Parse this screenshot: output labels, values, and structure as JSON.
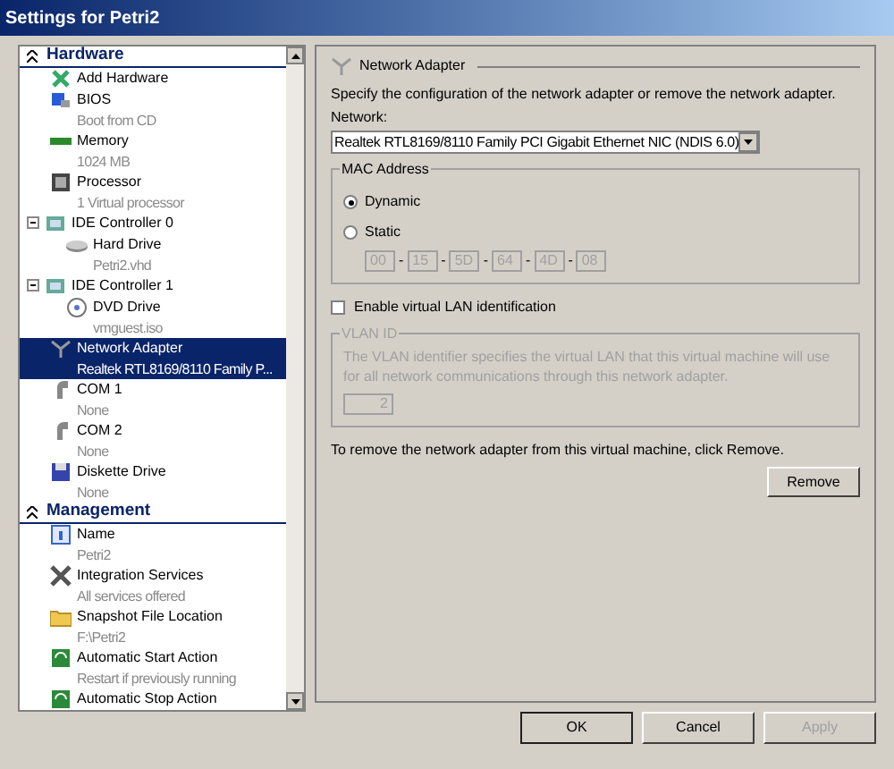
{
  "window": {
    "title": "Settings for Petri2"
  },
  "sidebar": {
    "sections": [
      {
        "label": "Hardware",
        "expanded": true,
        "items": [
          {
            "label": "Add Hardware",
            "kind": "add",
            "selected": false
          },
          {
            "label": "BIOS",
            "detail": "Boot from CD",
            "kind": "bios",
            "selected": false
          },
          {
            "label": "Memory",
            "detail": "1024 MB",
            "kind": "memory",
            "selected": false
          },
          {
            "label": "Processor",
            "detail": "1 Virtual processor",
            "kind": "cpu",
            "selected": false
          },
          {
            "label": "IDE Controller 0",
            "kind": "ide",
            "selected": false,
            "expanded": true,
            "children": [
              {
                "label": "Hard Drive",
                "detail": "Petri2.vhd",
                "kind": "disk",
                "selected": false
              }
            ]
          },
          {
            "label": "IDE Controller 1",
            "kind": "ide",
            "selected": false,
            "expanded": true,
            "children": [
              {
                "label": "DVD Drive",
                "detail": "vmguest.iso",
                "kind": "dvd",
                "selected": false
              }
            ]
          },
          {
            "label": "Network Adapter",
            "detail": "Realtek RTL8169/8110 Family P...",
            "kind": "net",
            "selected": true
          },
          {
            "label": "COM 1",
            "detail": "None",
            "kind": "com",
            "selected": false
          },
          {
            "label": "COM 2",
            "detail": "None",
            "kind": "com",
            "selected": false
          },
          {
            "label": "Diskette Drive",
            "detail": "None",
            "kind": "floppy",
            "selected": false
          }
        ]
      },
      {
        "label": "Management",
        "expanded": true,
        "items": [
          {
            "label": "Name",
            "detail": "Petri2",
            "kind": "info",
            "selected": false
          },
          {
            "label": "Integration Services",
            "detail": "All services offered",
            "kind": "tools",
            "selected": false
          },
          {
            "label": "Snapshot File Location",
            "detail": "F:\\Petri2",
            "kind": "folder",
            "selected": false
          },
          {
            "label": "Automatic Start Action",
            "detail": "Restart if previously running",
            "kind": "action",
            "selected": false
          },
          {
            "label": "Automatic Stop Action",
            "kind": "action",
            "selected": false
          }
        ]
      }
    ]
  },
  "panel": {
    "title": "Network Adapter",
    "description": "Specify the configuration of the network adapter or remove the network adapter.",
    "network_label": "Network:",
    "network_value": "Realtek RTL8169/8110 Family PCI Gigabit Ethernet NIC (NDIS 6.0)",
    "mac_group": {
      "title": "MAC Address",
      "options": [
        {
          "label": "Dynamic",
          "selected": true
        },
        {
          "label": "Static",
          "selected": false
        }
      ],
      "separator": "-",
      "octets": [
        "00",
        "15",
        "5D",
        "64",
        "4D",
        "08"
      ],
      "disabled": true
    },
    "vlan_checkbox": {
      "label": "Enable virtual LAN identification",
      "checked": false
    },
    "vlan_group": {
      "title": "VLAN ID",
      "text": "The VLAN identifier specifies the virtual LAN that this virtual machine will use for all network communications through this network adapter.",
      "value": "2",
      "disabled": true
    },
    "remove_text": "To remove the network adapter from this virtual machine, click Remove.",
    "remove_button": "Remove"
  },
  "buttons": [
    {
      "label": "OK",
      "disabled": false
    },
    {
      "label": "Cancel",
      "disabled": false
    },
    {
      "label": "Apply",
      "disabled": true
    }
  ]
}
